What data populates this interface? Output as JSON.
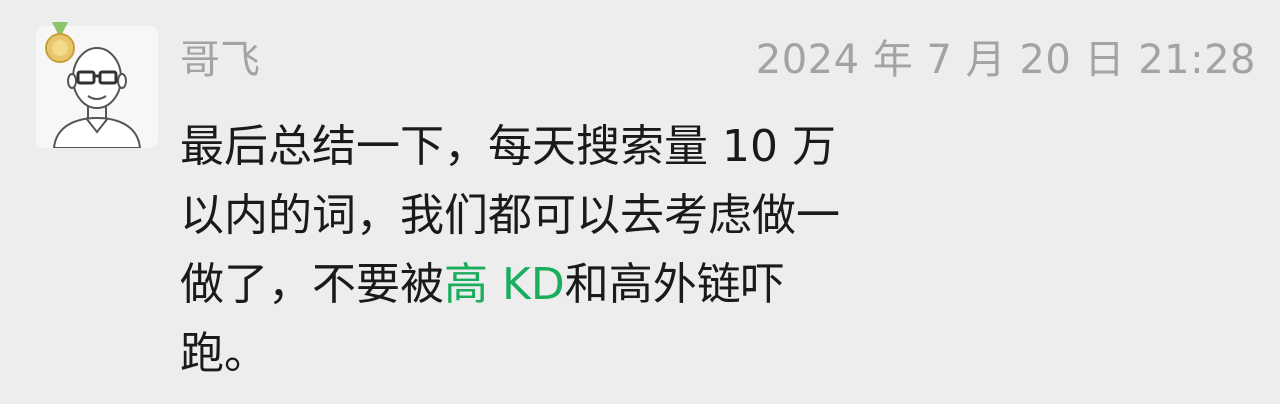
{
  "message": {
    "sender": "哥飞",
    "timestamp": "2024 年 7 月 20 日 21:28",
    "lines": [
      {
        "text": "最后总结一下，每天搜索量 10 万"
      },
      {
        "text": "以内的词，我们都可以去考虑做一"
      },
      {
        "before": "做了，不要被",
        "link": "高 KD",
        "after": "和高外链吓"
      },
      {
        "text": "跑。"
      }
    ]
  },
  "colors": {
    "background": "#ededed",
    "muted_text": "#a3a3a3",
    "body_text": "#1a1a1a",
    "link": "#1aad5e"
  },
  "icons": {
    "avatar": "bald-man-with-glasses-avatar",
    "badge": "gold-medal-badge-icon"
  }
}
